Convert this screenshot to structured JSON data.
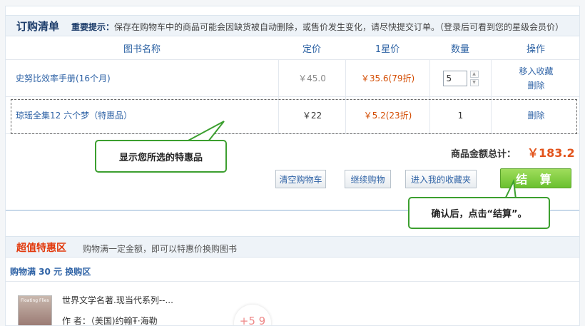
{
  "cart": {
    "title": "订购清单",
    "notice_bold": "重要提示：",
    "notice_text": "保存在购物车中的商品可能会因缺货被自动删除，或售价发生变化，请尽快提交订单。（登录后可看到您的星级会员价）"
  },
  "table": {
    "headers": [
      "图书名称",
      "定价",
      "1星价",
      "数量",
      "操作"
    ],
    "rows": [
      {
        "name": "史努比效率手册(16个月)",
        "price": "￥45.0",
        "member_price": "￥35.6(79折)",
        "qty": "5",
        "action1": "移入收藏",
        "action2": "删除"
      },
      {
        "name": "琼瑶全集12 六个梦（特惠品）",
        "price": "￥22",
        "member_price": "￥5.2(23折)",
        "qty": "1",
        "action1": "删除"
      }
    ]
  },
  "summary": {
    "total_label": "商品金额总计：",
    "total_value": "￥183.2"
  },
  "buttons": {
    "clear": "清空购物车",
    "continue": "继续购物",
    "favorites": "进入我的收藏夹",
    "checkout": "结 算"
  },
  "callouts": {
    "special": "显示您所选的特惠品",
    "checkout": "确认后，点击“结算”。"
  },
  "bonus": {
    "title": "超值特惠区",
    "desc": "购物满一定金额，即可以特惠价换购图书",
    "zone": "购物满 30 元 换购区"
  },
  "product": {
    "thumb_text": "Floating Flies",
    "title": "世界文学名著.现当代系列--...",
    "author": "作 者：（美国)约翰Ŧ·海勒",
    "badge": "+5 9"
  },
  "colors": {
    "accent_blue": "#2f63a6",
    "price_red": "#d34b00",
    "total_red": "#e2531b",
    "checkout_green": "#6ac02f",
    "callout_border": "#3c9f2f"
  }
}
